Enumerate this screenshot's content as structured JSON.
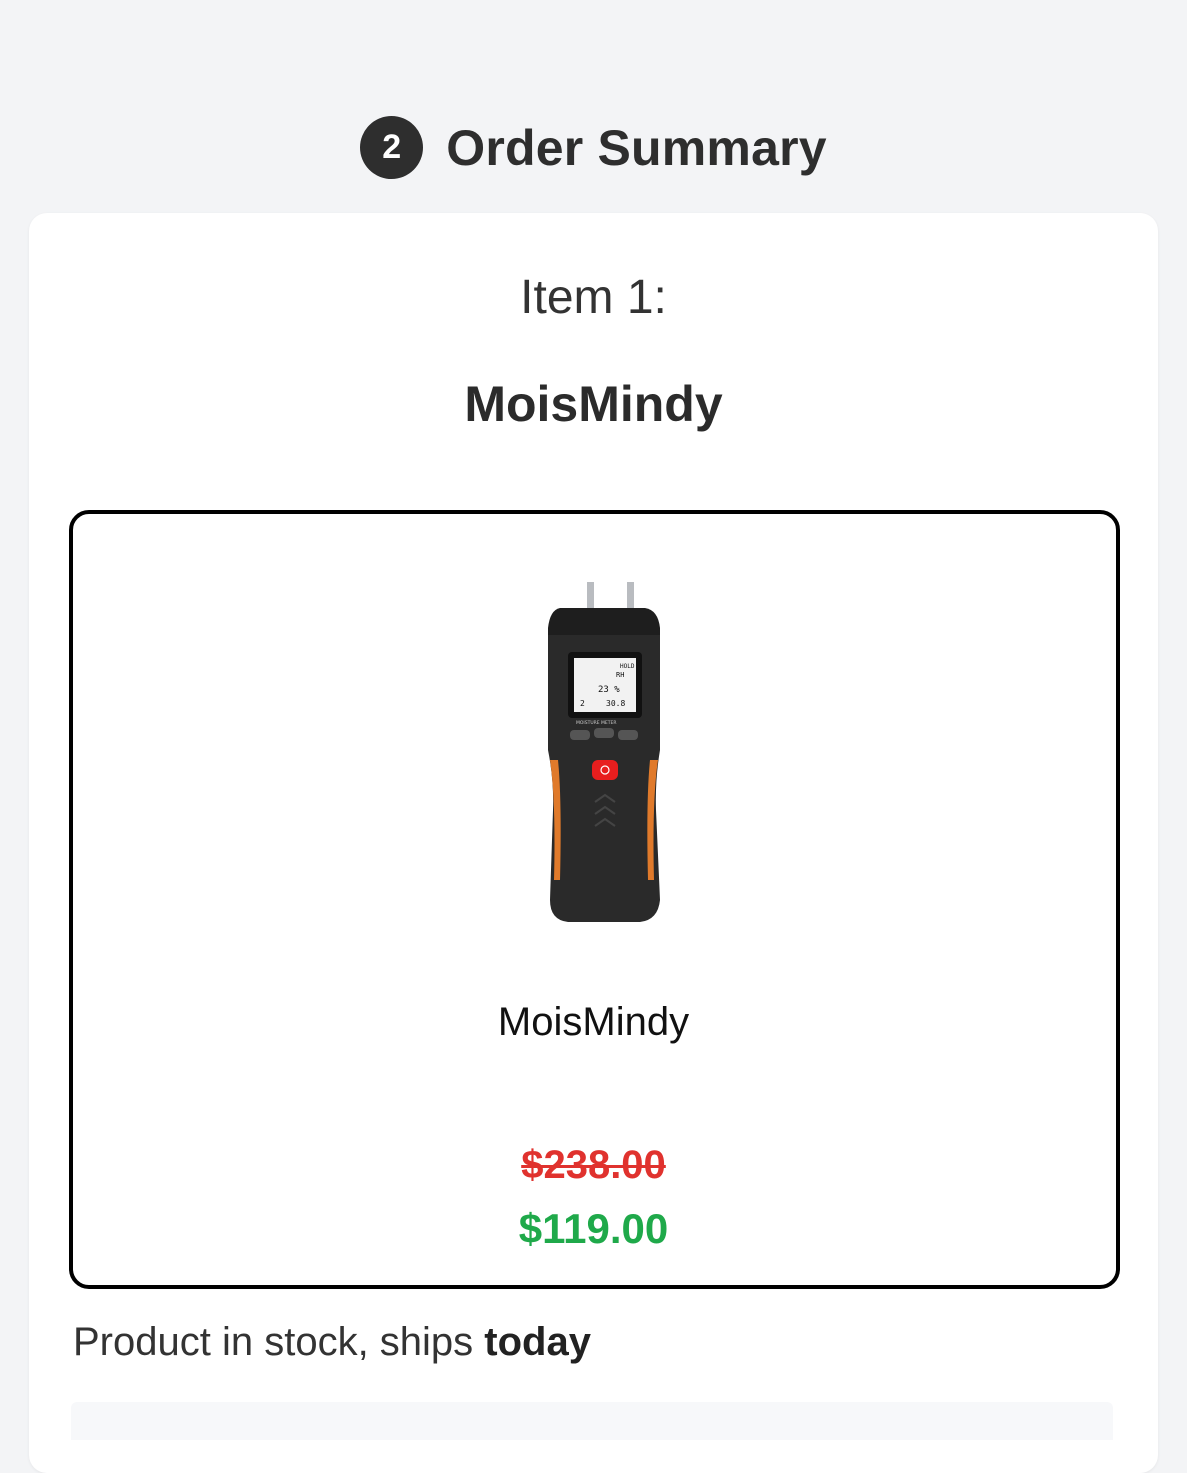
{
  "section": {
    "step_number": "2",
    "title": "Order Summary"
  },
  "item": {
    "label": "Item 1:",
    "name": "MoisMindy",
    "image_icon": "moisture-meter-image",
    "product_name": "MoisMindy",
    "price_original": "$238.00",
    "price_sale": "$119.00"
  },
  "stock": {
    "text_prefix": "Product in stock, ships ",
    "text_emphasis": "today"
  },
  "colors": {
    "page_bg": "#f3f4f6",
    "card_bg": "#ffffff",
    "price_original": "#e0322e",
    "price_sale": "#1fa94a",
    "accent_dark": "#2e2e2e"
  }
}
